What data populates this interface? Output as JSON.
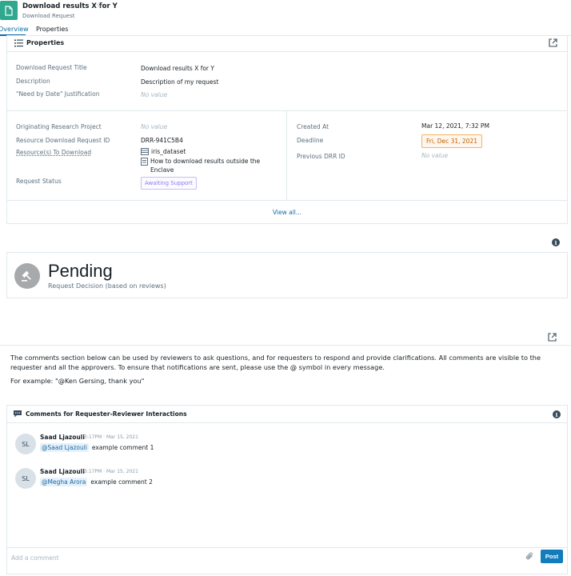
{
  "header": {
    "title": "Download results X for Y",
    "subtitle": "Download Request",
    "star": "☆"
  },
  "tabs": [
    "Overview",
    "Properties"
  ],
  "properties": {
    "heading": "Properties",
    "title_label": "Download Request Title",
    "title_value": "Download results X for Y",
    "description_label": "Description",
    "description_value": "Description of my request",
    "justification_label": "\"Need by Date\" Justification",
    "justification_value": "No value",
    "orig_project_label": "Originating Research Project",
    "orig_project_value": "No value",
    "request_id_label": "Resource Download Request ID",
    "request_id_value": "DRR-941C5B4",
    "resources_label": "Resource(s) To Download",
    "resources": [
      "iris_dataset",
      "How to download results outside the Enclave"
    ],
    "status_label": "Request Status",
    "status_value": "Awaiting Support",
    "created_label": "Created At",
    "created_value": "Mar 12, 2021, 7:32 PM",
    "deadline_label": "Deadline",
    "deadline_value": "Fri, Dec 31, 2021",
    "prev_label": "Previous DRR ID",
    "prev_value": "No value",
    "view_all": "View all..."
  },
  "decision": {
    "title": "Pending",
    "subtitle": "Request Decision (based on reviews)"
  },
  "instructions": {
    "paragraph": "The comments section below can be used by reviewers to ask questions, and for requesters to respond and provide clarifications. All comments are visible to the requester and all the approvers. To ensure that notifications are sent, please use the @ symbol in every message.",
    "example": "For example: \"@Ken Gersing, thank you\""
  },
  "comments": {
    "heading": "Comments for Requester-Reviewer Interactions",
    "items": [
      {
        "initials": "SL",
        "author": "Saad Ljazouli",
        "time": "3:17PM · Mar 15, 2021",
        "mention": "@Saad Ljazouli",
        "text": "example comment 1"
      },
      {
        "initials": "SL",
        "author": "Saad Ljazouli",
        "time": "3:17PM · Mar 15, 2021",
        "mention": "@Megha Arora",
        "text": "example comment 2"
      }
    ],
    "input_placeholder": "Add a comment",
    "post_label": "Post"
  },
  "icons": {
    "info": "i"
  },
  "colors": {
    "accent": "#106ba3",
    "app_icon": "#2fa88f",
    "deadline": "#bf5e00",
    "status": "#9179f2"
  }
}
